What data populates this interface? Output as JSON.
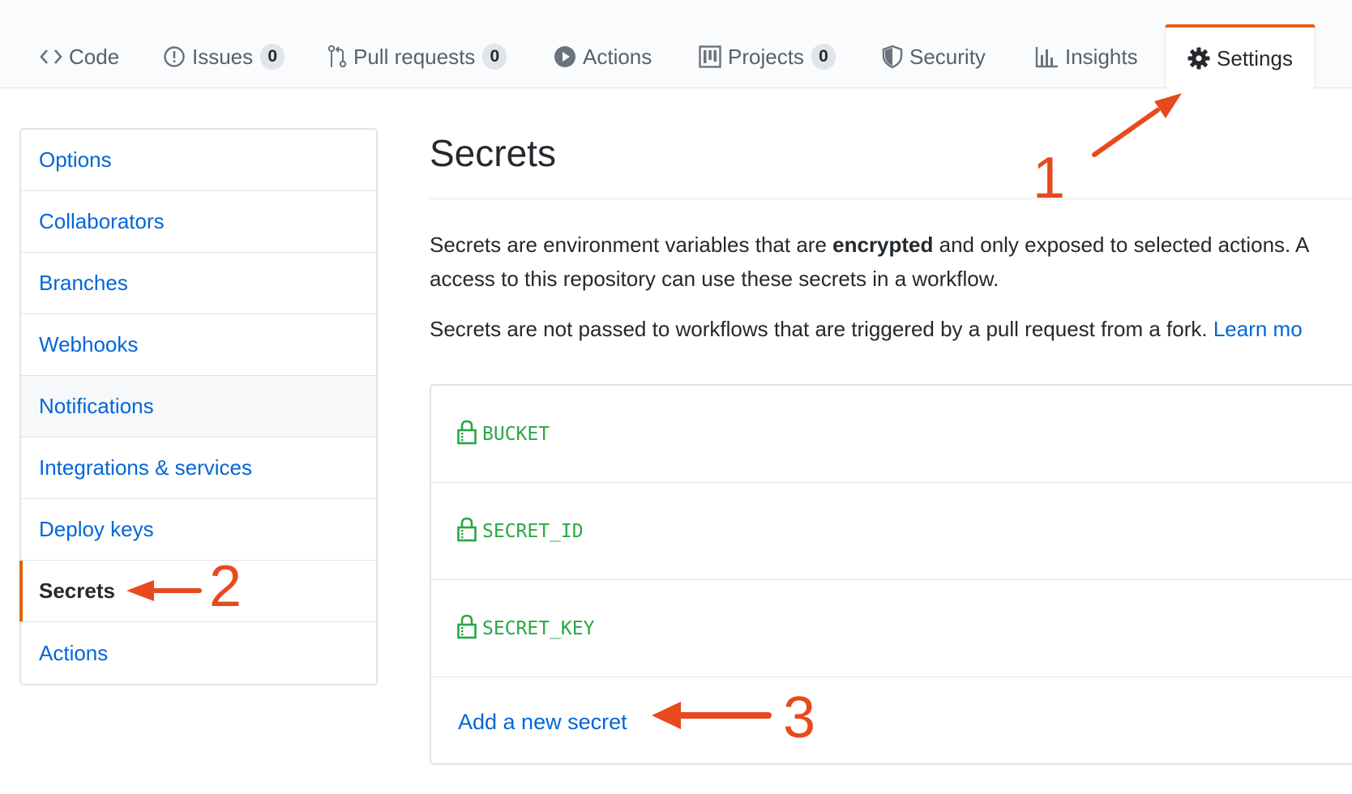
{
  "tabs": [
    {
      "label": "Code",
      "icon": "code-icon"
    },
    {
      "label": "Issues",
      "icon": "issue-icon",
      "count": "0"
    },
    {
      "label": "Pull requests",
      "icon": "pull-request-icon",
      "count": "0"
    },
    {
      "label": "Actions",
      "icon": "play-icon"
    },
    {
      "label": "Projects",
      "icon": "project-icon",
      "count": "0"
    },
    {
      "label": "Security",
      "icon": "shield-icon"
    },
    {
      "label": "Insights",
      "icon": "graph-icon"
    },
    {
      "label": "Settings",
      "icon": "gear-icon",
      "selected": true
    }
  ],
  "sidebar": {
    "items": [
      {
        "label": "Options"
      },
      {
        "label": "Collaborators"
      },
      {
        "label": "Branches"
      },
      {
        "label": "Webhooks"
      },
      {
        "label": "Notifications",
        "hover": true
      },
      {
        "label": "Integrations & services"
      },
      {
        "label": "Deploy keys"
      },
      {
        "label": "Secrets",
        "selected": true
      },
      {
        "label": "Actions"
      }
    ]
  },
  "main": {
    "title": "Secrets",
    "para1_pre": "Secrets are environment variables that are ",
    "para1_bold": "encrypted",
    "para1_post": " and only exposed to selected actions. A",
    "para1_line2": "access to this repository can use these secrets in a workflow.",
    "para2": "Secrets are not passed to workflows that are triggered by a pull request from a fork. ",
    "para2_link": "Learn mo",
    "secrets": [
      {
        "name": "BUCKET",
        "icon": "lock-icon"
      },
      {
        "name": "SECRET_ID",
        "icon": "lock-icon"
      },
      {
        "name": "SECRET_KEY",
        "icon": "lock-icon"
      }
    ],
    "add_link": "Add a new secret"
  },
  "annotations": {
    "step1": "1",
    "step2": "2",
    "step3": "3"
  },
  "colors": {
    "accent": "#e36209",
    "link": "#0366d6",
    "secret_green": "#28a745",
    "annotation_red": "#e8491d"
  }
}
